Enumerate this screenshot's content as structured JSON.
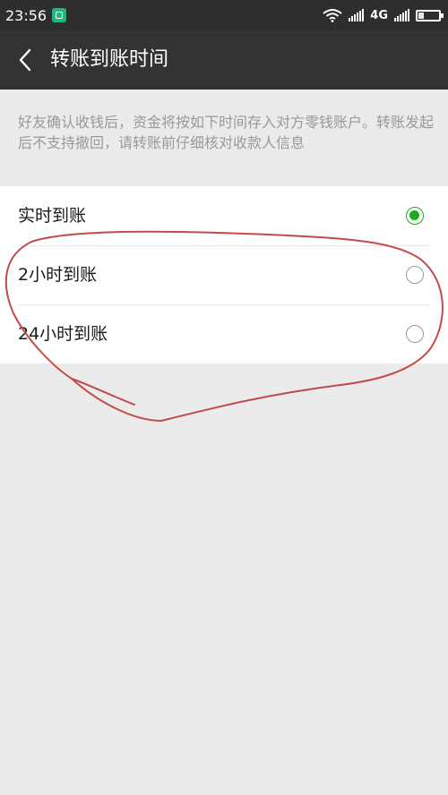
{
  "status_bar": {
    "time": "23:56",
    "network": "4G",
    "battery_level": 0.25
  },
  "header": {
    "title": "转账到账时间",
    "back_icon": "chevron-left-icon"
  },
  "description": "好友确认收钱后，资金将按如下时间存入对方零钱账户。转账发起后不支持撤回，请转账前仔细核对收款人信息",
  "options": [
    {
      "label": "实时到账",
      "selected": true
    },
    {
      "label": "2小时到账",
      "selected": false
    },
    {
      "label": "24小时到账",
      "selected": false
    }
  ],
  "colors": {
    "accent": "#1aad19",
    "header_bg": "#333333",
    "annotation": "#c44a4a"
  }
}
